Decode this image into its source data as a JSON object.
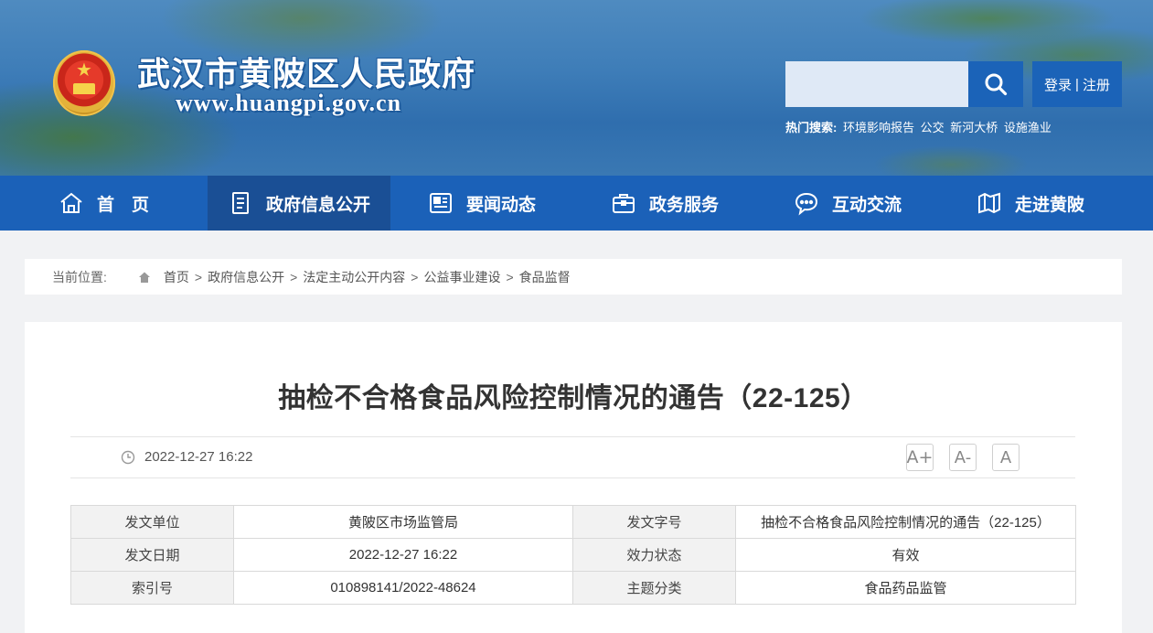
{
  "header": {
    "site_title": "武汉市黄陂区人民政府",
    "site_domain": "www.huangpi.gov.cn",
    "search_placeholder": "",
    "login_label": "登录",
    "divider": "|",
    "register_label": "注册",
    "hot_search_label": "热门搜索:",
    "hot_search_items": [
      "环境影响报告",
      "公交",
      "新河大桥",
      "设施渔业"
    ]
  },
  "nav": {
    "items": [
      {
        "label": "首　页",
        "icon": "home-icon"
      },
      {
        "label": "政府信息公开",
        "icon": "document-list-icon"
      },
      {
        "label": "要闻动态",
        "icon": "news-icon"
      },
      {
        "label": "政务服务",
        "icon": "briefcase-icon"
      },
      {
        "label": "互动交流",
        "icon": "chat-bubble-icon"
      },
      {
        "label": "走进黄陂",
        "icon": "map-icon"
      }
    ],
    "active_index": 1
  },
  "breadcrumb": {
    "label": "当前位置:",
    "items": [
      "首页",
      "政府信息公开",
      "法定主动公开内容",
      "公益事业建设",
      "食品监督"
    ],
    "separator": ">"
  },
  "article": {
    "title": "抽检不合格食品风险控制情况的通告（22-125）",
    "date": "2022-12-27 16:22",
    "font_controls": [
      "A+",
      "A-",
      "A"
    ],
    "info": {
      "rows": [
        [
          {
            "key": "发文单位",
            "value": "黄陂区市场监管局"
          },
          {
            "key": "发文字号",
            "value": "抽检不合格食品风险控制情况的通告（22-125）"
          }
        ],
        [
          {
            "key": "发文日期",
            "value": "2022-12-27 16:22"
          },
          {
            "key": "效力状态",
            "value": "有效"
          }
        ],
        [
          {
            "key": "索引号",
            "value": "010898141/2022-48624"
          },
          {
            "key": "主题分类",
            "value": "食品药品监管"
          }
        ]
      ]
    }
  },
  "colors": {
    "nav_bg": "#1b61b8",
    "nav_active_bg": "#1a4f95",
    "search_btn_bg": "#1b63b8",
    "page_bg": "#f1f2f4"
  }
}
